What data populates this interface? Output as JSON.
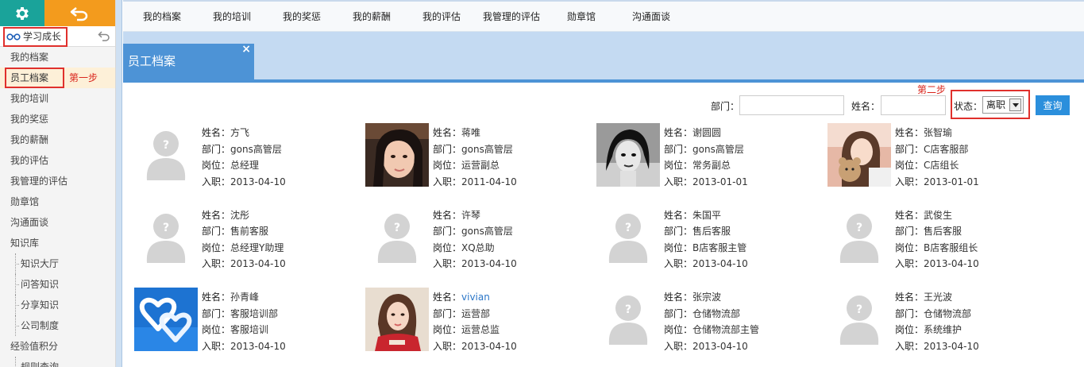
{
  "sidebar": {
    "section_title": "学习成长",
    "items": [
      {
        "label": "我的档案",
        "active": false,
        "sub": false
      },
      {
        "label": "员工档案",
        "active": true,
        "sub": false
      },
      {
        "label": "我的培训",
        "active": false,
        "sub": false
      },
      {
        "label": "我的奖惩",
        "active": false,
        "sub": false
      },
      {
        "label": "我的薪酬",
        "active": false,
        "sub": false
      },
      {
        "label": "我的评估",
        "active": false,
        "sub": false
      },
      {
        "label": "我管理的评估",
        "active": false,
        "sub": false
      },
      {
        "label": "勋章馆",
        "active": false,
        "sub": false
      },
      {
        "label": "沟通面谈",
        "active": false,
        "sub": false
      },
      {
        "label": "知识库",
        "active": false,
        "sub": false
      },
      {
        "label": "知识大厅",
        "active": false,
        "sub": true
      },
      {
        "label": "问答知识",
        "active": false,
        "sub": true
      },
      {
        "label": "分享知识",
        "active": false,
        "sub": true
      },
      {
        "label": "公司制度",
        "active": false,
        "sub": true
      },
      {
        "label": "经验值积分",
        "active": false,
        "sub": false
      },
      {
        "label": "规则查询",
        "active": false,
        "sub": true
      }
    ],
    "step1_note": "第一步"
  },
  "topnav": [
    "我的档案",
    "我的培训",
    "我的奖惩",
    "我的薪酬",
    "我的评估",
    "我管理的评估",
    "勋章馆",
    "沟通面谈"
  ],
  "tab": {
    "title": "员工档案",
    "close": "×"
  },
  "search": {
    "step2_note": "第二步",
    "dept_label": "部门：",
    "name_label": "姓名：",
    "status_label": "状态：",
    "status_value": "离职",
    "query_label": "查询"
  },
  "labels": {
    "name": "姓名：",
    "dept": "部门：",
    "post": "岗位：",
    "join": "入职："
  },
  "colors": {
    "accent_blue": "#4d93d6",
    "highlight_red": "#e0302c",
    "gear_bg": "#1aa39a",
    "back_bg": "#f39b1d"
  },
  "employees": [
    {
      "name": "方飞",
      "dept": "gons高管层",
      "post": "总经理",
      "join": "2013-04-10",
      "photo": "placeholder",
      "name_link": false
    },
    {
      "name": "蒋唯",
      "dept": "gons高管层",
      "post": "运营副总",
      "join": "2011-04-10",
      "photo": "girl-portrait",
      "name_link": false
    },
    {
      "name": "谢圆圆",
      "dept": "gons高管层",
      "post": "常务副总",
      "join": "2013-01-01",
      "photo": "bw-portrait",
      "name_link": false
    },
    {
      "name": "张智瑜",
      "dept": "C店客服部",
      "post": "C店组长",
      "join": "2013-01-01",
      "photo": "girl-teddy",
      "name_link": false
    },
    {
      "name": "沈彤",
      "dept": "售前客服",
      "post": "总经理Y助理",
      "join": "2013-04-10",
      "photo": "placeholder",
      "name_link": false
    },
    {
      "name": "许琴",
      "dept": "gons高管层",
      "post": "XQ总助",
      "join": "2013-04-10",
      "photo": "placeholder",
      "name_link": false
    },
    {
      "name": "朱国平",
      "dept": "售后客服",
      "post": "B店客服主管",
      "join": "2013-04-10",
      "photo": "placeholder",
      "name_link": false
    },
    {
      "name": "武俊生",
      "dept": "售后客服",
      "post": "B店客服组长",
      "join": "2013-04-10",
      "photo": "placeholder",
      "name_link": false
    },
    {
      "name": "孙青峰",
      "dept": "客服培训部",
      "post": "客服培训",
      "join": "2013-04-10",
      "photo": "cloud-hearts",
      "name_link": false
    },
    {
      "name": "vivian",
      "dept": "运营部",
      "post": "运营总监",
      "join": "2013-04-10",
      "photo": "girl-red",
      "name_link": true
    },
    {
      "name": "张宗波",
      "dept": "仓储物流部",
      "post": "仓储物流部主管",
      "join": "2013-04-10",
      "photo": "placeholder",
      "name_link": false
    },
    {
      "name": "王光波",
      "dept": "仓储物流部",
      "post": "系统维护",
      "join": "2013-04-10",
      "photo": "placeholder",
      "name_link": false
    }
  ]
}
